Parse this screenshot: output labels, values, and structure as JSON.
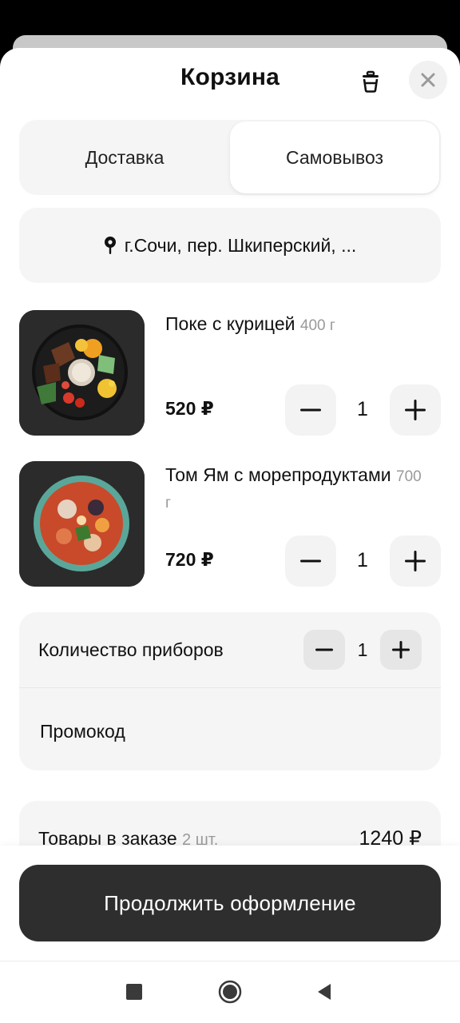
{
  "header": {
    "title": "Корзина",
    "trash_icon": "trash-icon",
    "close_icon": "close-icon"
  },
  "delivery_toggle": {
    "options": [
      "Доставка",
      "Самовывоз"
    ],
    "selected": "Самовывоз"
  },
  "address": {
    "icon": "location-pin-icon",
    "text": "г.Сочи, пер. Шкиперский, ..."
  },
  "cart_items": [
    {
      "name": "Поке с курицей",
      "weight": "400 г",
      "price": "520 ₽",
      "quantity": "1"
    },
    {
      "name": "Том Ям с морепродуктами",
      "weight": "700 г",
      "price": "720 ₽",
      "quantity": "1"
    }
  ],
  "cutlery": {
    "label": "Количество приборов",
    "quantity": "1"
  },
  "promo": {
    "label": "Промокод"
  },
  "summary": {
    "label": "Товары в заказе",
    "count": "2 шт.",
    "total": "1240 ₽"
  },
  "checkout": {
    "label": "Продолжить оформление"
  },
  "system_nav": {
    "icons": [
      "recent-apps-icon",
      "home-icon",
      "back-icon"
    ]
  },
  "colors": {
    "primary_button": "#2e2e2e",
    "card_background": "#f5f5f5",
    "muted_text": "#9a9a9a"
  }
}
